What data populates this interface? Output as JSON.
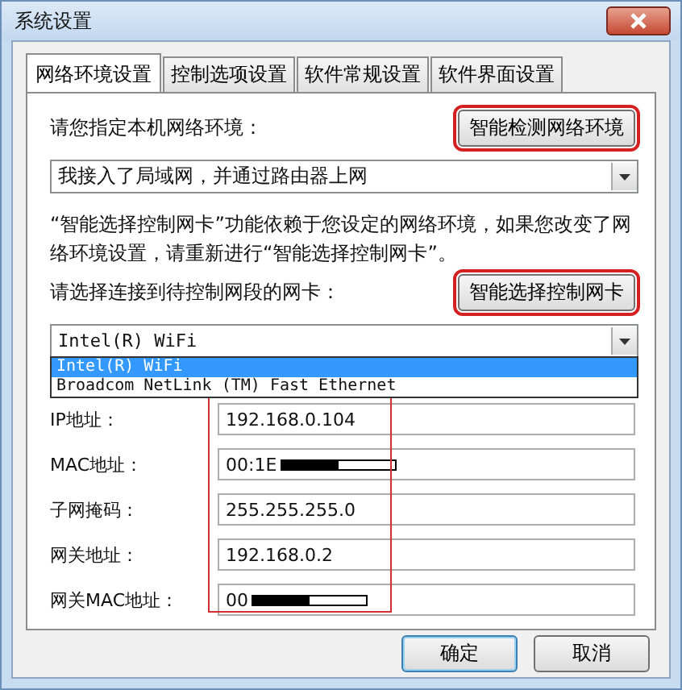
{
  "window": {
    "title": "系统设置"
  },
  "tabs": [
    {
      "label": "网络环境设置",
      "selected": true
    },
    {
      "label": "控制选项设置",
      "selected": false
    },
    {
      "label": "软件常规设置",
      "selected": false
    },
    {
      "label": "软件界面设置",
      "selected": false
    }
  ],
  "environment": {
    "label": "请您指定本机网络环境：",
    "detect_button": "智能检测网络环境",
    "value": "我接入了局域网，并通过路由器上网"
  },
  "note": "“智能选择控制网卡”功能依赖于您设定的网络环境，如果您改变了网络环境设置，请重新进行“智能选择控制网卡”。",
  "adapter": {
    "label": "请选择连接到待控制网段的网卡：",
    "select_button": "智能选择控制网卡",
    "value": "Intel(R) WiFi",
    "expanded": true,
    "options": [
      {
        "label": "Intel(R) WiFi",
        "selected": true
      },
      {
        "label": "Broadcom NetLink (TM) Fast Ethernet",
        "selected": false
      }
    ]
  },
  "fields": [
    {
      "label": "IP地址：",
      "value": "192.168.0.104",
      "redacted": false
    },
    {
      "label": "MAC地址：",
      "value": "00:1E",
      "redacted": true
    },
    {
      "label": "子网掩码：",
      "value": "255.255.255.0",
      "redacted": false
    },
    {
      "label": "网关地址：",
      "value": "192.168.0.2",
      "redacted": false
    },
    {
      "label": "网关MAC地址：",
      "value": "00",
      "redacted": true
    }
  ],
  "buttons": [
    {
      "label": "确定",
      "default": true
    },
    {
      "label": "取消",
      "default": false
    }
  ]
}
